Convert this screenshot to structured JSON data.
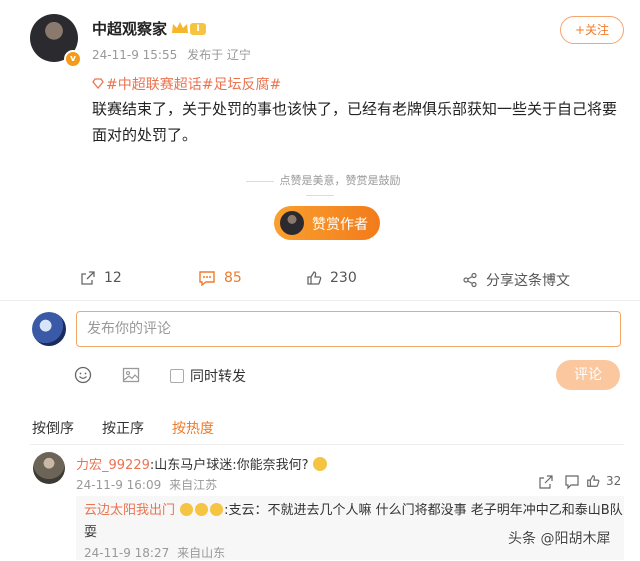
{
  "post": {
    "author": "中超观察家",
    "level_badge": "I",
    "time": "24-11-9 15:55",
    "published_from": "发布于 辽宁",
    "follow_label": "+关注",
    "topic": "#中超联赛超话#足坛反腐#",
    "text": "联赛结束了，关于处罚的事也该快了，已经有老牌俱乐部获知一些关于自己将要面对的处罚了。",
    "tip": "点赞是美意，赞赏是鼓励",
    "reward_label": "赞赏作者"
  },
  "actions": {
    "repost_count": "12",
    "comment_count": "85",
    "like_count": "230",
    "share_label": "分享这条博文"
  },
  "comment_box": {
    "placeholder": "发布你的评论",
    "repost_label": "同时转发",
    "submit_label": "评论"
  },
  "sort_tabs": [
    "按倒序",
    "按正序",
    "按热度"
  ],
  "comments": [
    {
      "user": "力宏_99229",
      "text": ":山东马户球迷:你能奈我何?",
      "time": "24-11-9 16:09",
      "location": "来自江苏",
      "like_count": "32",
      "reply": {
        "user": "云边太阳我出门",
        "text": ":支云：不就进去几个人嘛 什么门将都没事 老子明年冲中乙和泰山B队耍",
        "time": "24-11-9 18:27",
        "location": "来自山东"
      }
    }
  ],
  "watermark": "头条 @阳胡木犀",
  "colors": {
    "accent": "#f07a2a",
    "topic": "#eb7350",
    "submit_disabled": "#fbc79e"
  }
}
